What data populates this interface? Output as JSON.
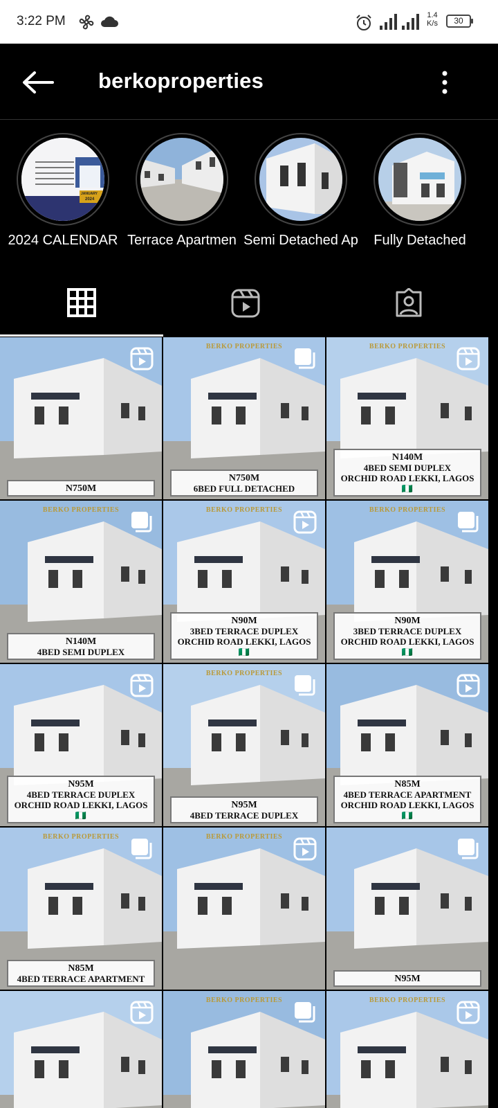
{
  "status_bar": {
    "time": "3:22 PM",
    "net_speed_value": "1.4",
    "net_speed_unit": "K/s",
    "battery": "30",
    "icons": [
      "fan-icon",
      "cloud-icon",
      "alarm-icon",
      "signal-icon",
      "signal-icon"
    ]
  },
  "header": {
    "title": "berkoproperties",
    "back_icon": "arrow-left-icon",
    "more_icon": "more-vertical-icon"
  },
  "highlights": [
    {
      "label": "2024 CALENDAR",
      "calendar_month": "JANUARY",
      "calendar_year": "2024"
    },
    {
      "label": "Terrace Apartmen"
    },
    {
      "label": "Semi Detached Ap"
    },
    {
      "label": "Fully Detached"
    }
  ],
  "tabs": [
    {
      "name": "grid",
      "icon": "grid-icon",
      "selected": true
    },
    {
      "name": "reels",
      "icon": "reels-icon",
      "selected": false
    },
    {
      "name": "tagged",
      "icon": "tagged-person-icon",
      "selected": false
    }
  ],
  "posts": [
    {
      "type": "reel",
      "brand": "",
      "lines": [
        "N750M"
      ]
    },
    {
      "type": "carousel",
      "brand": "BERKO PROPERTIES",
      "lines": [
        "N750M",
        "6BED FULL DETACHED"
      ]
    },
    {
      "type": "reel",
      "brand": "BERKO PROPERTIES",
      "lines": [
        "N140M",
        "4BED SEMI DUPLEX",
        "ORCHID ROAD LEKKI, LAGOS 🇳🇬"
      ]
    },
    {
      "type": "carousel",
      "brand": "BERKO PROPERTIES",
      "lines": [
        "N140M",
        "4BED SEMI DUPLEX"
      ]
    },
    {
      "type": "reel",
      "brand": "BERKO PROPERTIES",
      "lines": [
        "N90M",
        "3BED TERRACE DUPLEX",
        "ORCHID ROAD LEKKI, LAGOS 🇳🇬"
      ]
    },
    {
      "type": "carousel",
      "brand": "BERKO PROPERTIES",
      "lines": [
        "N90M",
        "3BED TERRACE DUPLEX",
        "ORCHID ROAD LEKKI, LAGOS 🇳🇬"
      ]
    },
    {
      "type": "reel",
      "brand": "",
      "lines": [
        "N95M",
        "4BED TERRACE DUPLEX",
        "ORCHID ROAD LEKKI, LAGOS 🇳🇬"
      ]
    },
    {
      "type": "carousel",
      "brand": "BERKO PROPERTIES",
      "lines": [
        "N95M",
        "4BED TERRACE DUPLEX"
      ]
    },
    {
      "type": "reel",
      "brand": "",
      "lines": [
        "N85M",
        "4BED TERRACE APARTMENT",
        "ORCHID ROAD LEKKI, LAGOS 🇳🇬"
      ]
    },
    {
      "type": "carousel",
      "brand": "BERKO PROPERTIES",
      "lines": [
        "N85M",
        "4BED TERRACE APARTMENT"
      ]
    },
    {
      "type": "reel",
      "brand": "BERKO PROPERTIES",
      "lines": []
    },
    {
      "type": "carousel",
      "brand": "",
      "lines": [
        "N95M"
      ]
    },
    {
      "type": "reel",
      "brand": "",
      "lines": []
    },
    {
      "type": "carousel",
      "brand": "BERKO PROPERTIES",
      "lines": []
    },
    {
      "type": "reel",
      "brand": "BERKO PROPERTIES",
      "lines": []
    }
  ]
}
